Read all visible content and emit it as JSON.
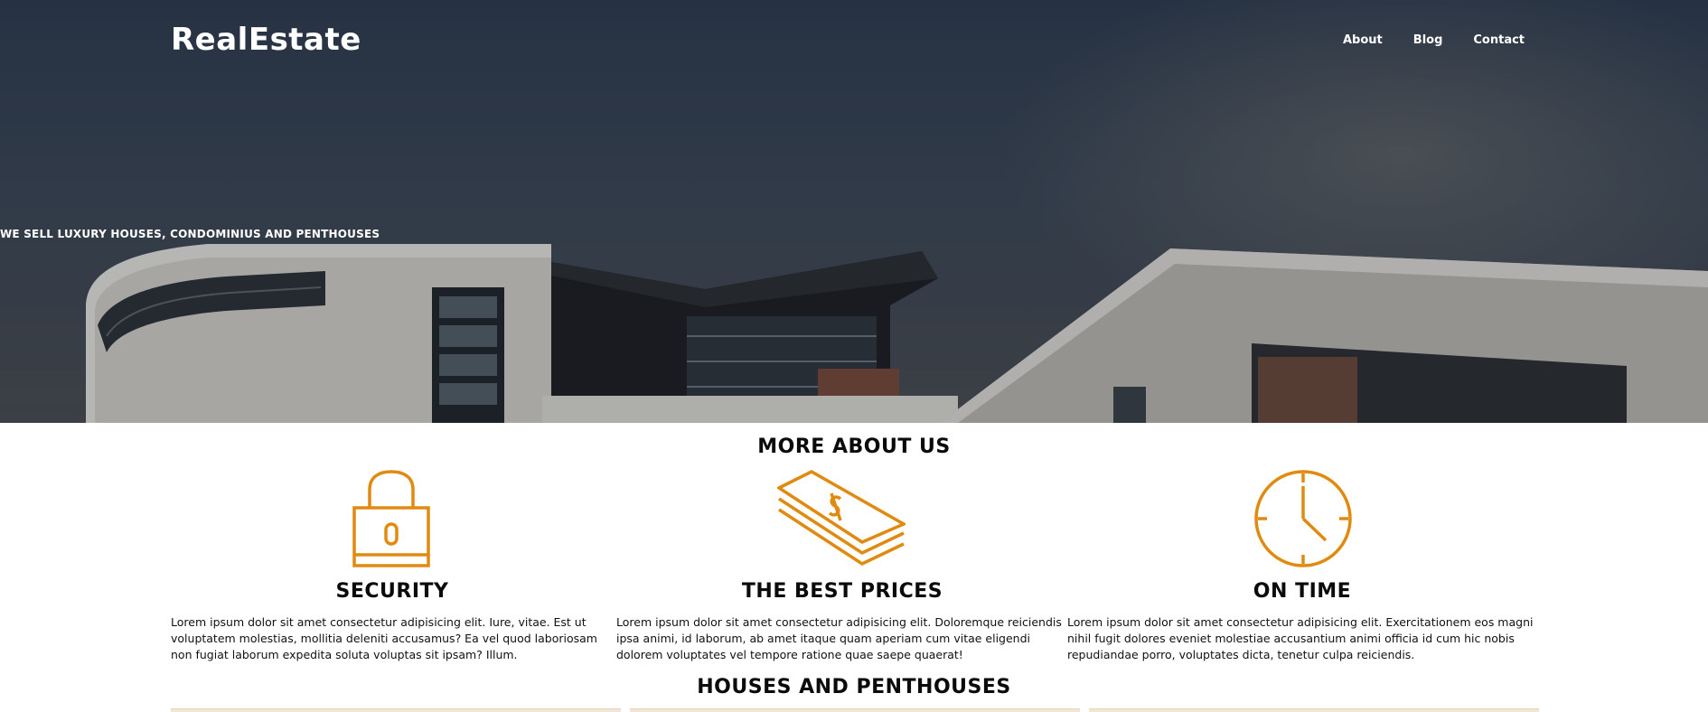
{
  "header": {
    "brand": "RealEstate",
    "nav": [
      "About",
      "Blog",
      "Contact"
    ],
    "tagline": "WE SELL LUXURY HOUSES, CONDOMINIUS AND PENTHOUSES"
  },
  "about": {
    "title": "MORE ABOUT US",
    "features": [
      {
        "icon": "padlock-icon",
        "title": "SECURITY",
        "body": "Lorem ipsum dolor sit amet consectetur adipisicing elit. Iure, vitae. Est ut voluptatem molestias, mollitia deleniti accusamus? Ea vel quod laboriosam non fugiat laborum expedita soluta voluptas sit ipsam? Illum."
      },
      {
        "icon": "money-stack-icon",
        "title": "THE BEST PRICES",
        "body": "Lorem ipsum dolor sit amet consectetur adipisicing elit. Doloremque reiciendis ipsa animi, id laborum, ab amet itaque quam aperiam cum vitae eligendi dolorem voluptates vel tempore ratione quae saepe quaerat!"
      },
      {
        "icon": "clock-icon",
        "title": "ON TIME",
        "body": "Lorem ipsum dolor sit amet consectetur adipisicing elit. Exercitationem eos magni nihil fugit dolores eveniet molestiae accusantium animi officia id cum hic nobis repudiandae porro, voluptates dicta, tenetur culpa reiciendis."
      }
    ]
  },
  "houses": {
    "title": "HOUSES AND PENTHOUSES"
  },
  "colors": {
    "accent": "#e08a10",
    "text": "#111111",
    "white": "#ffffff"
  }
}
